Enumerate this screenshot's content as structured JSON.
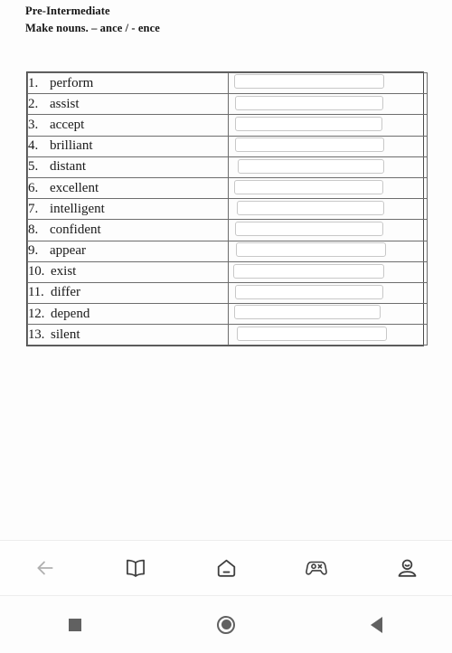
{
  "worksheet": {
    "level": "Pre-Intermediate",
    "instruction": "Make nouns. – ance / - ence",
    "rows": [
      {
        "num": "1.",
        "word": "perform"
      },
      {
        "num": "2.",
        "word": "assist"
      },
      {
        "num": "3.",
        "word": "accept"
      },
      {
        "num": "4.",
        "word": "brilliant"
      },
      {
        "num": "5.",
        "word": "distant"
      },
      {
        "num": "6.",
        "word": "excellent"
      },
      {
        "num": "7.",
        "word": "intelligent"
      },
      {
        "num": "8.",
        "word": "confident"
      },
      {
        "num": "9.",
        "word": "appear"
      },
      {
        "num": "10.",
        "word": "exist"
      },
      {
        "num": "11.",
        "word": "differ"
      },
      {
        "num": "12.",
        "word": "depend"
      },
      {
        "num": "13.",
        "word": "silent"
      }
    ],
    "answer_placeholder": "",
    "answer_values": [
      "",
      "",
      "",
      "",
      "",
      "",
      "",
      "",
      "",
      "",
      "",
      "",
      ""
    ]
  },
  "app_nav": {
    "items": [
      {
        "icon": "back-arrow-icon",
        "label": ""
      },
      {
        "icon": "book-icon",
        "label": ""
      },
      {
        "icon": "home-icon",
        "label": ""
      },
      {
        "icon": "game-controller-icon",
        "label": ""
      },
      {
        "icon": "profile-icon",
        "label": ""
      }
    ]
  },
  "system_bar": {
    "items": [
      {
        "icon": "recents-square-icon"
      },
      {
        "icon": "home-circle-icon"
      },
      {
        "icon": "back-triangle-icon"
      }
    ]
  },
  "colors": {
    "page_background": "#fdfdfd",
    "text": "#1a1a1a",
    "table_border": "#6d6d6d",
    "input_border": "#c8c8c8",
    "nav_icon": "#3f3f3f",
    "nav_icon_muted": "#b0b0b0",
    "system_icon": "#616161"
  }
}
